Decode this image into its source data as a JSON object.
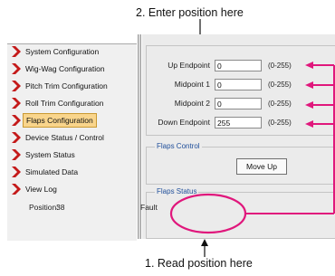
{
  "annotations": {
    "top": "2. Enter position here",
    "bottom": "1. Read position here",
    "highlight_color": "#e0177c"
  },
  "sidebar": {
    "items": [
      {
        "label": "System Configuration"
      },
      {
        "label": "Wig-Wag Configuration"
      },
      {
        "label": "Pitch Trim Configuration"
      },
      {
        "label": "Roll Trim Configuration"
      },
      {
        "label": "Flaps Configuration",
        "selected": true
      },
      {
        "label": "Device Status / Control"
      },
      {
        "label": "System Status"
      },
      {
        "label": "Simulated Data"
      },
      {
        "label": "View Log"
      }
    ],
    "icon": "red-chevron-icon",
    "selected_color": "#f9d58c"
  },
  "fields": [
    {
      "label": "Up Endpoint",
      "value": "0",
      "range": "(0-255)"
    },
    {
      "label": "Midpoint 1",
      "value": "0",
      "range": "(0-255)"
    },
    {
      "label": "Midpoint 2",
      "value": "0",
      "range": "(0-255)"
    },
    {
      "label": "Down Endpoint",
      "value": "255",
      "range": "(0-255)"
    }
  ],
  "flaps_control": {
    "title": "Flaps Control",
    "move_up_label": "Move Up"
  },
  "flaps_status": {
    "title": "Flaps Status",
    "position_label": "Position:",
    "position_value": "38",
    "fault_label": "Fault"
  }
}
